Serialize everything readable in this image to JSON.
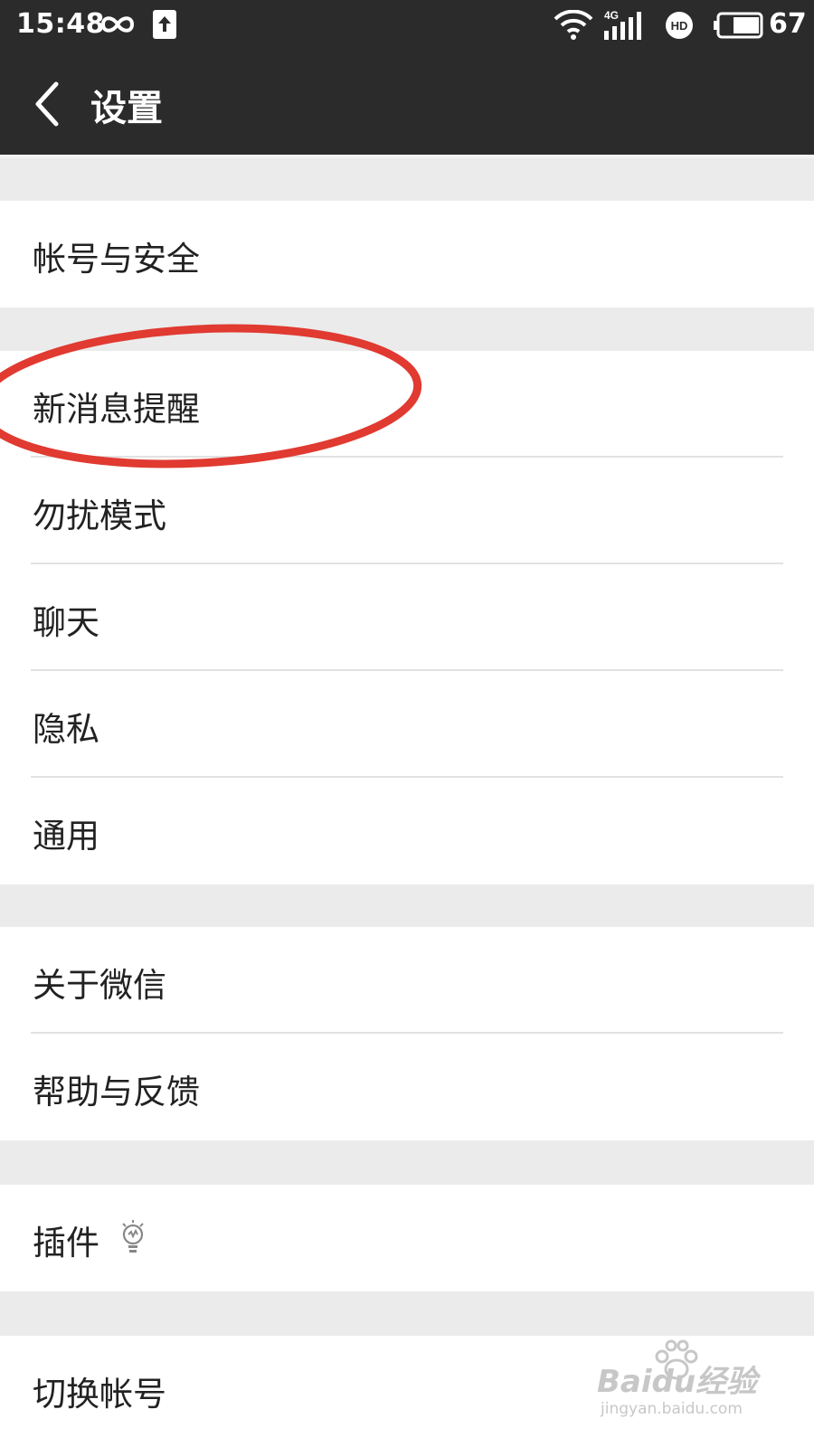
{
  "status_bar": {
    "time": "15:48",
    "network_type": "4G",
    "hd_label": "HD",
    "battery_percent": "67",
    "battery_level": 0.67
  },
  "header": {
    "title": "设置",
    "back_icon": "chevron-left-icon"
  },
  "settings": {
    "groups": [
      {
        "items": [
          {
            "label": "帐号与安全"
          }
        ]
      },
      {
        "items": [
          {
            "label": "新消息提醒"
          },
          {
            "label": "勿扰模式"
          },
          {
            "label": "聊天"
          },
          {
            "label": "隐私"
          },
          {
            "label": "通用"
          }
        ]
      },
      {
        "items": [
          {
            "label": "关于微信"
          },
          {
            "label": "帮助与反馈"
          }
        ]
      },
      {
        "items": [
          {
            "label": "插件",
            "icon": "lightbulb-icon"
          }
        ]
      },
      {
        "items": [
          {
            "label": "切换帐号"
          }
        ]
      }
    ]
  },
  "annotation": {
    "color": "#e03a31"
  },
  "watermark": {
    "brand": "Baidu经验",
    "url": "jingyan.baidu.com"
  },
  "colors": {
    "bar_bg": "#2b2b2b",
    "page_bg": "#ebebeb",
    "row_bg": "#ffffff"
  }
}
